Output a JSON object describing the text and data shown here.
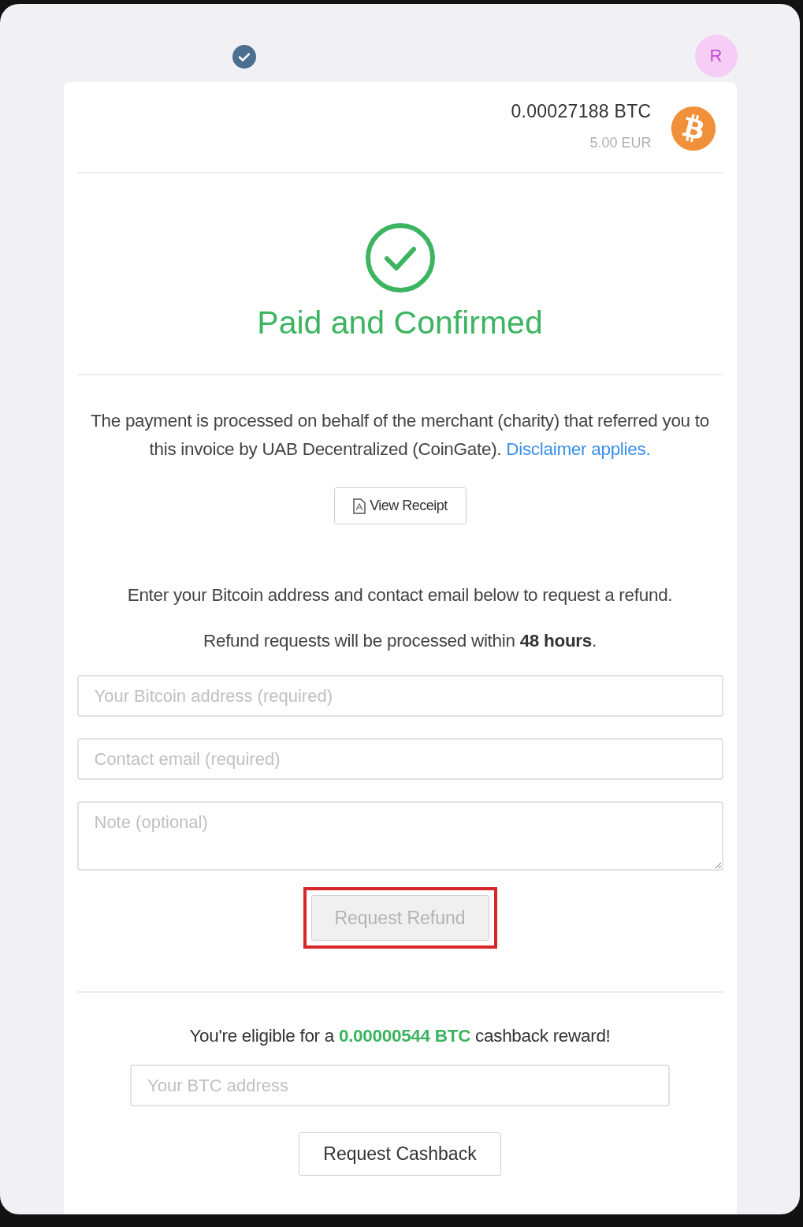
{
  "top_bar": {
    "verified": true,
    "avatar": "R"
  },
  "amount": {
    "crypto": "0.00027188 BTC",
    "fiat": "5.00 EUR"
  },
  "status": {
    "kind": "paid",
    "title": "Paid and Confirmed"
  },
  "description": {
    "text": "The payment is processed on behalf of the merchant (charity) that referred you to this invoice by UAB Decentralized (CoinGate).",
    "link": "Disclaimer applies."
  },
  "receipt_button": {
    "label": "View Receipt"
  },
  "refund": {
    "instructions": "Enter your Bitcoin address and contact email below to request a refund.",
    "note": "Refund requests will be processed within **48 hours**.",
    "fields": [
      {
        "kind": "input",
        "placeholder": "Your Bitcoin address (required)"
      },
      {
        "kind": "input",
        "placeholder": "Contact email (required)"
      },
      {
        "kind": "textarea",
        "placeholder": "Note (optional)"
      }
    ],
    "button": {
      "label": "Request Refund",
      "disabled": true,
      "highlighted": true
    }
  },
  "cashback": {
    "message": "You're eligible for a **0.00000544 BTC** cashback reward!",
    "field": {
      "placeholder": "Your BTC address"
    },
    "button": {
      "label": "Request Cashback"
    }
  }
}
